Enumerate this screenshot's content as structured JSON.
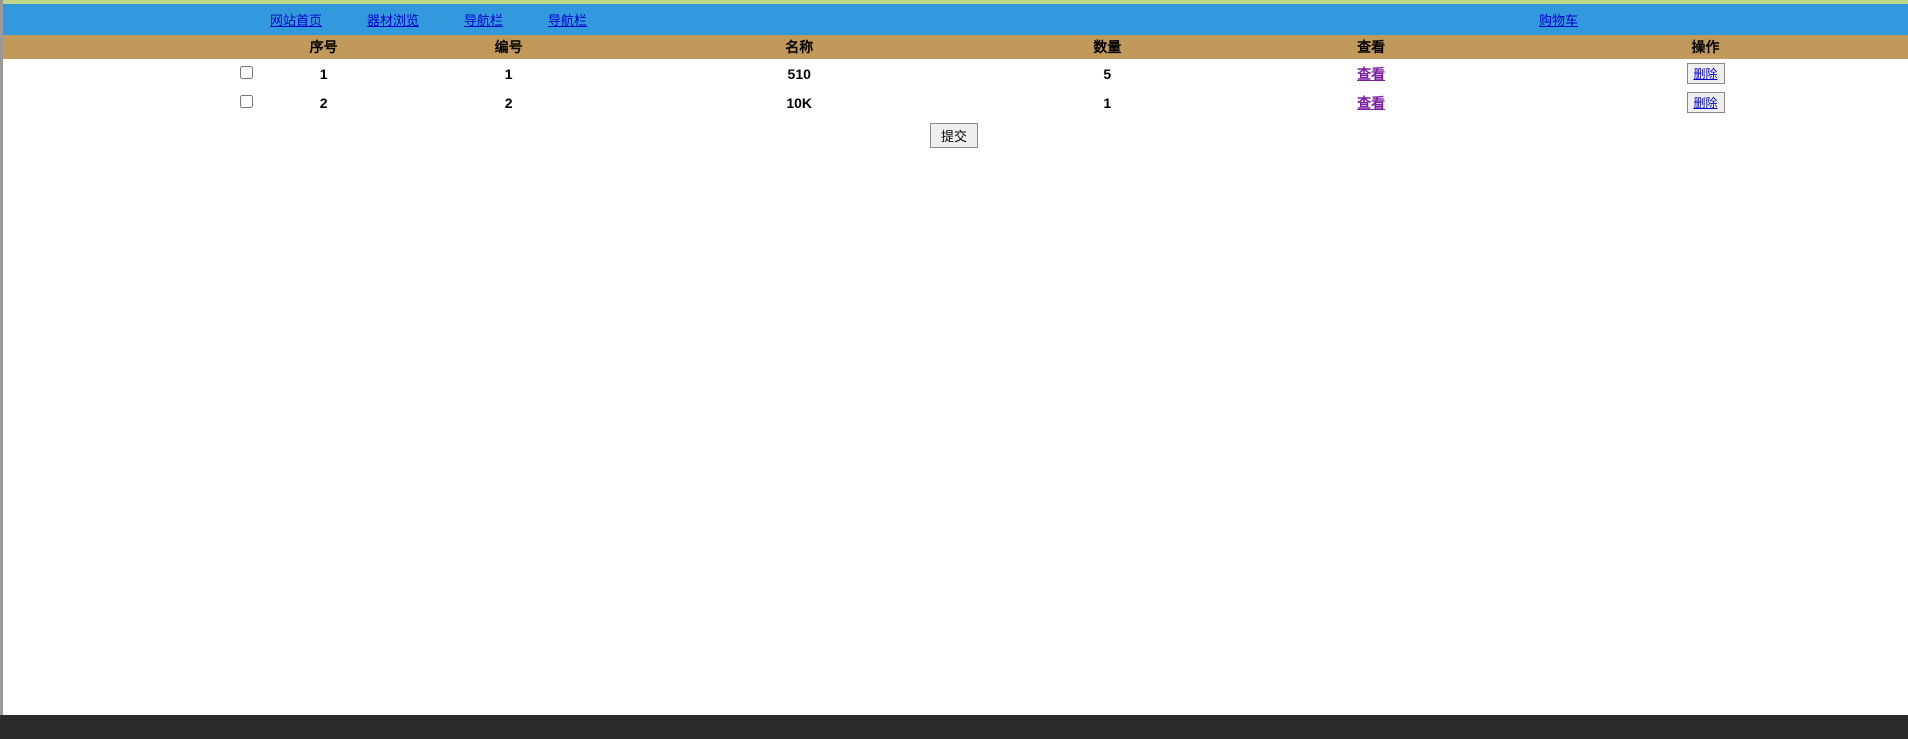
{
  "nav": {
    "left": [
      {
        "label": "网站首页"
      },
      {
        "label": "器材浏览"
      },
      {
        "label": "导航栏"
      },
      {
        "label": "导航栏"
      }
    ],
    "right": {
      "label": "购物车"
    }
  },
  "table": {
    "headers": {
      "checkbox": "",
      "seq": "序号",
      "id": "编号",
      "name": "名称",
      "qty": "数量",
      "view": "查看",
      "op": "操作"
    },
    "rows": [
      {
        "seq": "1",
        "id": "1",
        "name": "510",
        "qty": "5",
        "view": "查看",
        "del": "删除"
      },
      {
        "seq": "2",
        "id": "2",
        "name": "10K",
        "qty": "1",
        "view": "查看",
        "del": "删除"
      }
    ]
  },
  "submit_label": "提交"
}
